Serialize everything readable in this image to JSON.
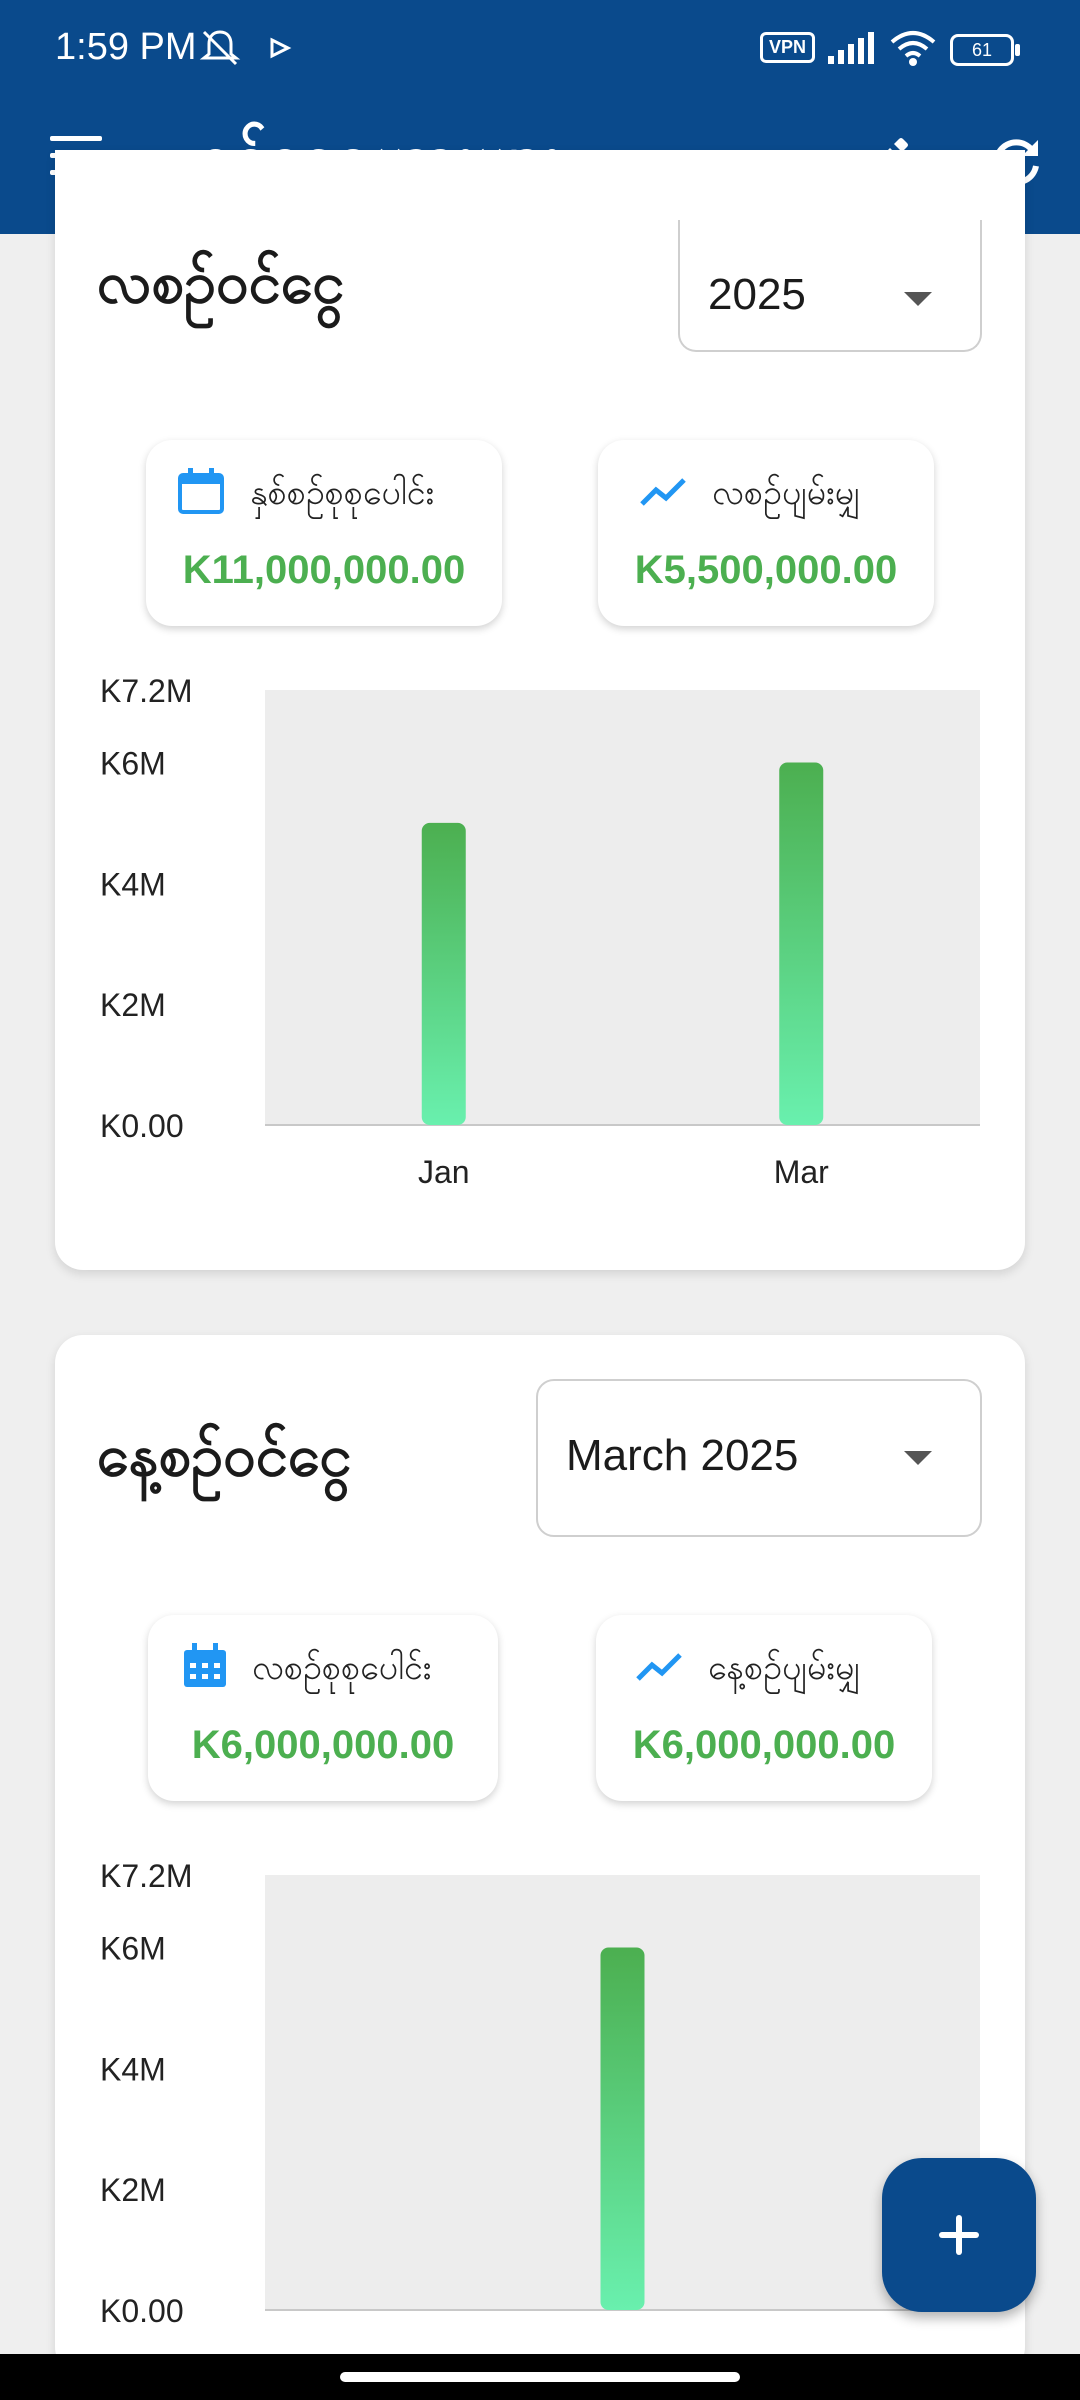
{
  "status_bar": {
    "time": "1:59 PM",
    "vpn": "VPN",
    "battery": "61",
    "icons": [
      "muted-bell-icon",
      "play-store-icon",
      "signal-icon",
      "wifi-icon",
      "battery-icon"
    ]
  },
  "app_bar": {
    "title": "ဝင်ငွေဇယားများ",
    "icons": [
      "menu-icon",
      "edit-icon",
      "refresh-icon"
    ]
  },
  "monthly": {
    "title": "လစဉ်ဝင်ငွေ",
    "selector": "2025",
    "total_label": "နှစ်စဉ်စုစုပေါင်း",
    "total_value": "K11,000,000.00",
    "avg_label": "လစဉ်ပျမ်းမျှ",
    "avg_value": "K5,500,000.00"
  },
  "daily": {
    "title": "နေ့စဉ်ဝင်ငွေ",
    "selector": "March 2025",
    "total_label": "လစဉ်စုစုပေါင်း",
    "total_value": "K6,000,000.00",
    "avg_label": "နေ့စဉ်ပျမ်းမျှ",
    "avg_value": "K6,000,000.00"
  },
  "colors": {
    "primary": "#0a4a8c",
    "accent_green": "#4caf50",
    "bar_top": "#4caf50",
    "bar_bottom": "#69f0ae",
    "icon_blue": "#2196f3"
  },
  "chart_data": [
    {
      "type": "bar",
      "categories": [
        "Jan",
        "Mar"
      ],
      "values": [
        5000000,
        6000000
      ],
      "title": "",
      "xlabel": "",
      "ylabel": "",
      "ylim": [
        0,
        7200000
      ],
      "y_ticks": [
        0,
        2000000,
        4000000,
        6000000,
        7200000
      ],
      "y_tick_labels": [
        "K0.00",
        "K2M",
        "K4M",
        "K6M",
        "K7.2M"
      ],
      "grid": false
    },
    {
      "type": "bar",
      "categories": [
        ""
      ],
      "values": [
        6000000
      ],
      "title": "",
      "xlabel": "",
      "ylabel": "",
      "ylim": [
        0,
        7200000
      ],
      "y_ticks": [
        0,
        2000000,
        4000000,
        6000000,
        7200000
      ],
      "y_tick_labels": [
        "K0.00",
        "K2M",
        "K4M",
        "K6M",
        "K7.2M"
      ],
      "grid": false
    }
  ]
}
